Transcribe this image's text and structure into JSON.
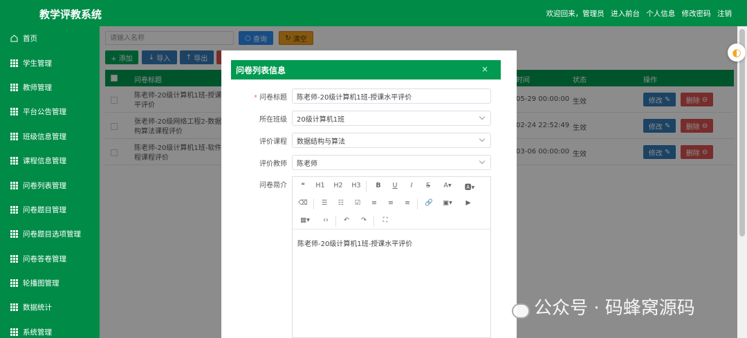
{
  "header": {
    "title": "教学评教系统",
    "links": [
      "欢迎回来，管理员",
      "进入前台",
      "个人信息",
      "修改密码",
      "注销"
    ]
  },
  "sidebar": {
    "items": [
      {
        "label": "首页",
        "icon": "home-icon"
      },
      {
        "label": "学生管理",
        "icon": "grid-icon"
      },
      {
        "label": "教师管理",
        "icon": "grid-icon"
      },
      {
        "label": "平台公告管理",
        "icon": "grid-icon"
      },
      {
        "label": "班级信息管理",
        "icon": "grid-icon"
      },
      {
        "label": "课程信息管理",
        "icon": "grid-icon"
      },
      {
        "label": "问卷列表管理",
        "icon": "grid-icon"
      },
      {
        "label": "问卷题目管理",
        "icon": "grid-icon"
      },
      {
        "label": "问卷题目选项管理",
        "icon": "grid-icon"
      },
      {
        "label": "问卷答卷管理",
        "icon": "grid-icon"
      },
      {
        "label": "轮播图管理",
        "icon": "grid-icon"
      },
      {
        "label": "数据统计",
        "icon": "grid-icon"
      },
      {
        "label": "系统管理",
        "icon": "grid-icon"
      }
    ]
  },
  "search": {
    "placeholder": "请输入名称",
    "query_label": "查询",
    "clear_label": "清空"
  },
  "actions": {
    "add": "+ 添加",
    "import": "导入",
    "export": "导出"
  },
  "table": {
    "headers": {
      "title": "问卷标题",
      "time": "时间",
      "status": "状态",
      "op": "操作"
    },
    "rows": [
      {
        "title": "陈老师-20级计算机1班-授课水平评价",
        "time": "05-29 00:00:00",
        "status": "生效",
        "edit": "修改",
        "del": "删除"
      },
      {
        "title": "张老师-20级网络工程2-数据结构算法课程评价",
        "time": "02-24 22:52:49",
        "status": "生效",
        "edit": "修改",
        "del": "删除"
      },
      {
        "title": "陈老师-20级计算机1班-软件工程课程评价",
        "time": "03-06 00:00:00",
        "status": "生效",
        "edit": "修改",
        "del": "删除"
      }
    ]
  },
  "modal": {
    "title": "问卷列表信息",
    "close": "×",
    "fields": {
      "title_label": "问卷标题",
      "title_value": "陈老师-20级计算机1班-授课水平评价",
      "class_label": "所在班级",
      "class_value": "20级计算机1班",
      "course_label": "评价课程",
      "course_value": "数据结构与算法",
      "teacher_label": "评价教师",
      "teacher_value": "陈老师",
      "intro_label": "问卷简介"
    },
    "editor": {
      "toolbar_row1": [
        "❝",
        "H1",
        "H2",
        "H3",
        "B",
        "U",
        "I",
        "S",
        "A▾",
        "🅰▾"
      ],
      "toolbar_row2": [
        "⌫",
        "☰",
        "☷",
        "☑",
        "≡",
        "≡",
        "≡",
        "🔗",
        "▣▾",
        "▶"
      ],
      "toolbar_row3": [
        "▦▾",
        "‹›",
        "↶",
        "↷",
        "⛶"
      ],
      "content": "陈老师-20级计算机1班-授课水平评价"
    }
  },
  "watermark": "公众号 · 码蜂窝源码",
  "colors": {
    "brand_green": "#008c47",
    "primary_blue": "#337ab7",
    "danger_red": "#d9534f",
    "warning": "#f0a020"
  }
}
